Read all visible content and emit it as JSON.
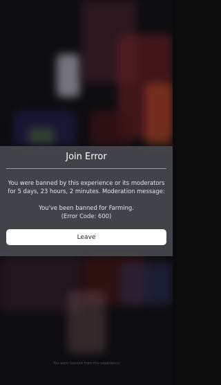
{
  "dialog": {
    "title": "Join Error",
    "message": "You were banned by this experience or its moderators for 5 days, 23 hours, 2 minutes. Moderation message:",
    "reason": "You've been banned for Farming.",
    "error_code": "(Error Code: 600)",
    "leave_label": "Leave"
  },
  "footer": {
    "note": "You were banned from this experience"
  },
  "colors": {
    "modal_background": "#46484c",
    "button_background": "#ffffff",
    "text": "#ffffff"
  }
}
